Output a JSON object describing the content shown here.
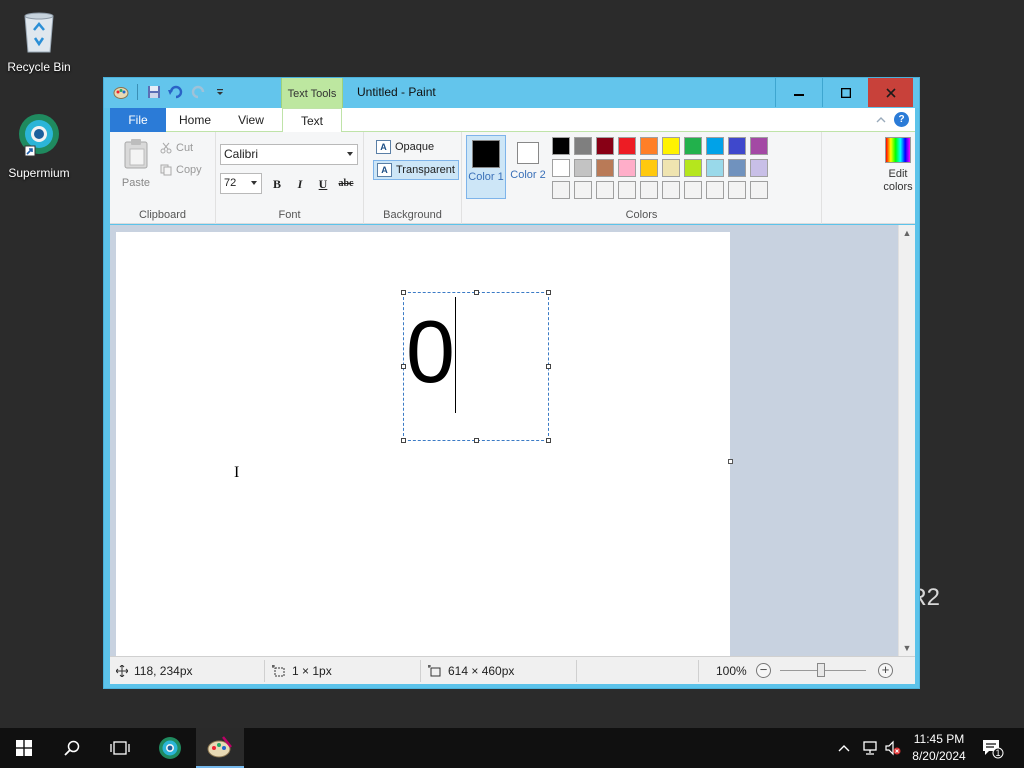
{
  "desktop": {
    "icons": [
      {
        "label": "Recycle Bin",
        "icon": "recycle-bin-icon"
      },
      {
        "label": "Supermium",
        "icon": "supermium-icon"
      }
    ],
    "watermark": "R2"
  },
  "window": {
    "title": "Untitled - Paint",
    "context_tab": "Text Tools",
    "controls": {
      "minimize": "—",
      "maximize": "□",
      "close": "✕"
    }
  },
  "ribbon": {
    "tabs": {
      "file": "File",
      "home": "Home",
      "view": "View",
      "text": "Text"
    },
    "clipboard": {
      "paste": "Paste",
      "cut": "Cut",
      "copy": "Copy",
      "group": "Clipboard"
    },
    "font": {
      "family": "Calibri",
      "size": "72",
      "bold": "B",
      "italic": "I",
      "underline": "U",
      "strike": "abc",
      "group": "Font"
    },
    "background": {
      "opaque": "Opaque",
      "transparent": "Transparent",
      "group": "Background",
      "icon_letter": "A"
    },
    "colors": {
      "color1": "Color 1",
      "color2": "Color 2",
      "color1_value": "#000000",
      "color2_value": "#ffffff",
      "edit": "Edit colors",
      "group": "Colors",
      "palette": [
        "#000000",
        "#7f7f7f",
        "#880015",
        "#ed1c24",
        "#ff7f27",
        "#fff200",
        "#22b14c",
        "#00a2e8",
        "#3f48cc",
        "#a349a4",
        "#ffffff",
        "#c3c3c3",
        "#b97a57",
        "#ffaec9",
        "#ffc90e",
        "#efe4b0",
        "#b5e61d",
        "#99d9ea",
        "#7092be",
        "#c8bfe7",
        "#f3f3f3",
        "#f3f3f3",
        "#f3f3f3",
        "#f3f3f3",
        "#f3f3f3",
        "#f3f3f3",
        "#f3f3f3",
        "#f3f3f3",
        "#f3f3f3",
        "#f3f3f3"
      ]
    }
  },
  "canvas": {
    "text_content": "0"
  },
  "status": {
    "position": "118, 234px",
    "selection": "1 × 1px",
    "size": "614 × 460px",
    "zoom": "100%",
    "zoom_minus": "−",
    "zoom_plus": "+"
  },
  "taskbar": {
    "time": "11:45 PM",
    "date": "8/20/2024",
    "notification_count": "1"
  }
}
